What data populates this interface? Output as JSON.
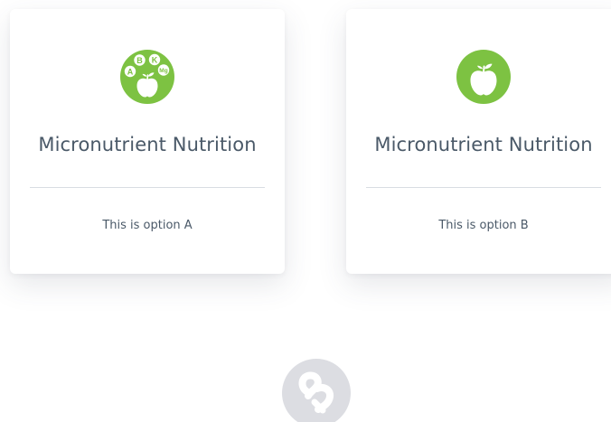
{
  "options": [
    {
      "title": "Micronutrient Nutrition",
      "description": "This is option A",
      "icon": "apple-vitamins-icon",
      "icon_badges": [
        "A",
        "B",
        "K",
        "Mg"
      ]
    },
    {
      "title": "Micronutrient Nutrition",
      "description": "This is option B",
      "icon": "apple-icon"
    }
  ],
  "colors": {
    "icon_green": "#7dc242",
    "title_text": "#4a5968",
    "divider": "#d8dde2",
    "logo_grey": "#dcdde2"
  },
  "footer": {
    "logo": "brand-logo-icon"
  }
}
